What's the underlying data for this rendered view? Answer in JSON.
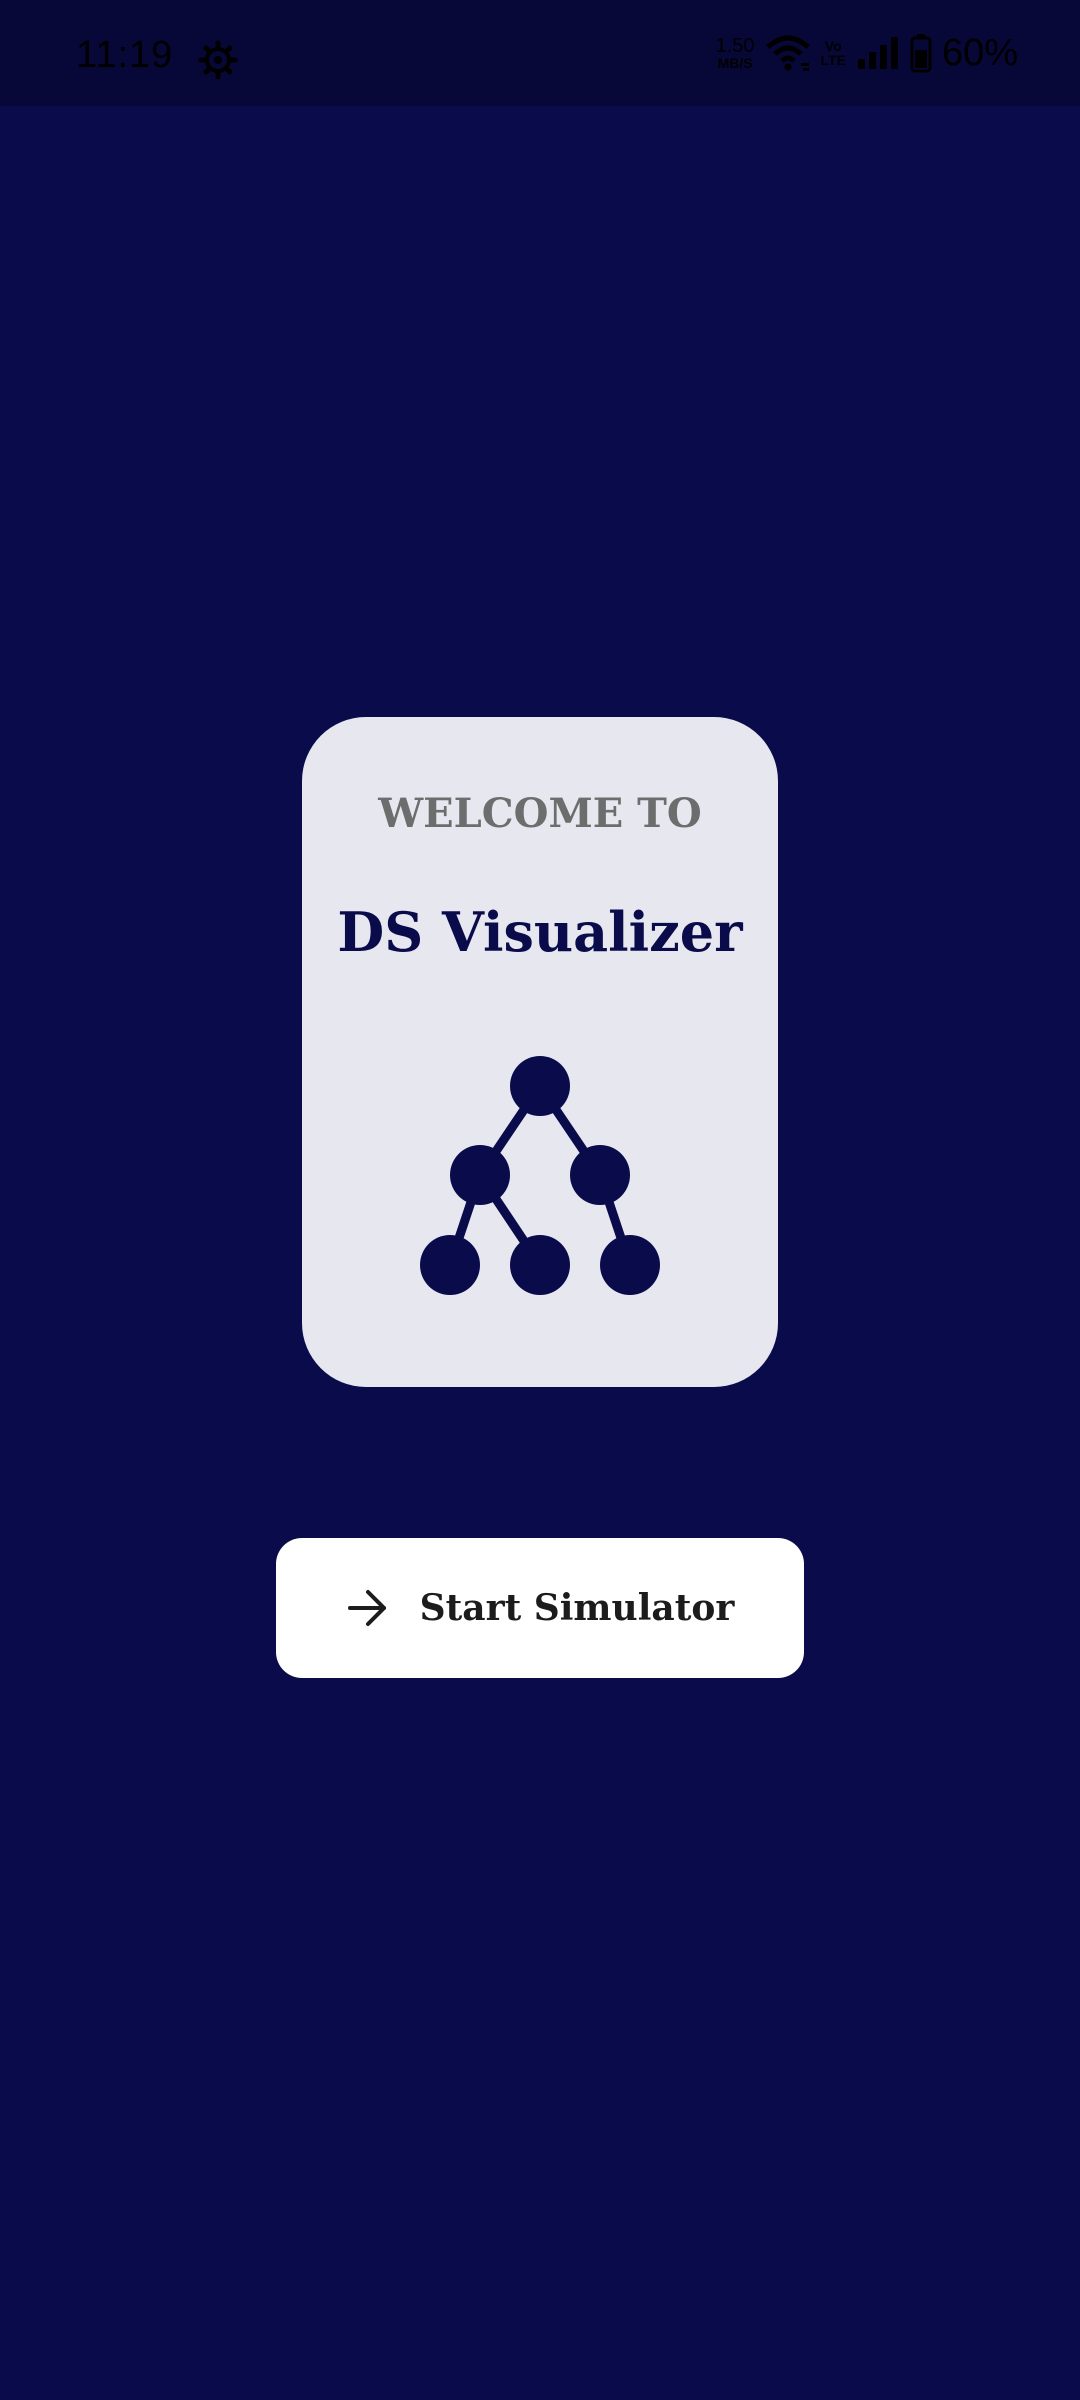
{
  "status_bar": {
    "time": "11:19",
    "net_speed_value": "1.50",
    "net_speed_unit": "MB/S",
    "volte_top": "Vo",
    "volte_bottom": "LTE",
    "battery": "60%",
    "icons": [
      "settings-gear-icon",
      "wifi-icon",
      "signal-icon",
      "battery-icon"
    ]
  },
  "welcome": {
    "label": "WELCOME TO",
    "title": "DS Visualizer",
    "icon": "tree-icon"
  },
  "actions": {
    "start_label": "Start Simulator",
    "start_icon": "arrow-right-icon"
  },
  "colors": {
    "background": "#0a0b4b",
    "card": "#e6e7ef",
    "button": "#ffffff",
    "accent": "#0a0b4b"
  }
}
